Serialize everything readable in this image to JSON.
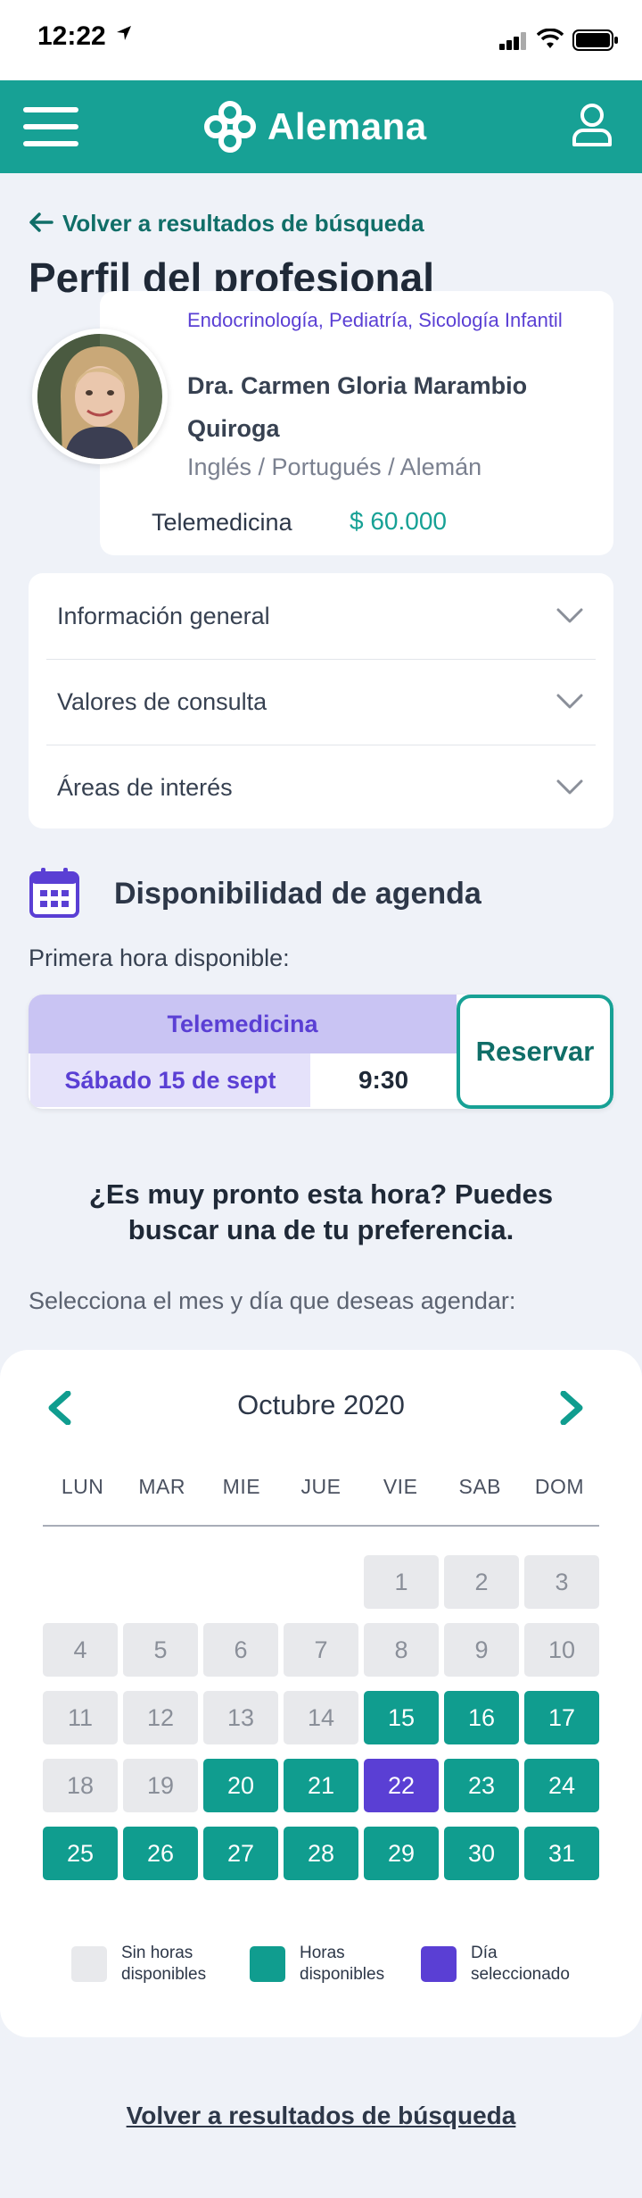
{
  "status_bar": {
    "time": "12:22"
  },
  "header": {
    "logo_text": "Alemana",
    "brand_color": "#17a195"
  },
  "back_top": "Volver a resultados de búsqueda",
  "page_title": "Perfil del profesional",
  "profile": {
    "specialties": "Endocrinología, Pediatría, Sicología Infantil",
    "name": "Dra. Carmen Gloria Marambio Quiroga",
    "languages": "Inglés / Portugués / Alemán",
    "modality": "Telemedicina",
    "price": "$ 60.000"
  },
  "accordion": [
    {
      "label": "Información general"
    },
    {
      "label": "Valores de consulta"
    },
    {
      "label": "Áreas de interés"
    }
  ],
  "agenda": {
    "title": "Disponibilidad de agenda",
    "first_label": "Primera hora disponible:",
    "slot_modality": "Telemedicina",
    "slot_date": "Sábado 15 de sept",
    "slot_time": "9:30",
    "reserve_label": "Reservar"
  },
  "prompt": "¿Es muy pronto esta hora? Puedes buscar una de tu preferencia.",
  "select_label": "Selecciona el mes y día que deseas agendar:",
  "calendar": {
    "month_label": "Octubre  2020",
    "weekdays": [
      "LUN",
      "MAR",
      "MIE",
      "JUE",
      "VIE",
      "SAB",
      "DOM"
    ],
    "days": [
      {
        "d": "1",
        "s": "none"
      },
      {
        "d": "2",
        "s": "none"
      },
      {
        "d": "3",
        "s": "none"
      },
      {
        "d": "4",
        "s": "none"
      },
      {
        "d": "5",
        "s": "none"
      },
      {
        "d": "6",
        "s": "none"
      },
      {
        "d": "7",
        "s": "none"
      },
      {
        "d": "8",
        "s": "none"
      },
      {
        "d": "9",
        "s": "none"
      },
      {
        "d": "10",
        "s": "none"
      },
      {
        "d": "11",
        "s": "none"
      },
      {
        "d": "12",
        "s": "none"
      },
      {
        "d": "13",
        "s": "none"
      },
      {
        "d": "14",
        "s": "none"
      },
      {
        "d": "15",
        "s": "avail"
      },
      {
        "d": "16",
        "s": "avail"
      },
      {
        "d": "17",
        "s": "avail"
      },
      {
        "d": "18",
        "s": "none"
      },
      {
        "d": "19",
        "s": "none"
      },
      {
        "d": "20",
        "s": "avail"
      },
      {
        "d": "21",
        "s": "avail"
      },
      {
        "d": "22",
        "s": "sel"
      },
      {
        "d": "23",
        "s": "avail"
      },
      {
        "d": "24",
        "s": "avail"
      },
      {
        "d": "25",
        "s": "avail"
      },
      {
        "d": "26",
        "s": "avail"
      },
      {
        "d": "27",
        "s": "avail"
      },
      {
        "d": "28",
        "s": "avail"
      },
      {
        "d": "29",
        "s": "avail"
      },
      {
        "d": "30",
        "s": "avail"
      },
      {
        "d": "31",
        "s": "avail"
      }
    ],
    "legend": [
      {
        "label": "Sin horas disponibles",
        "color": "#e8e9ec"
      },
      {
        "label": "Horas disponibles",
        "color": "#109d8f"
      },
      {
        "label": "Día seleccionado",
        "color": "#5a3fd4"
      }
    ]
  },
  "back_bottom": "Volver a resultados de búsqueda"
}
